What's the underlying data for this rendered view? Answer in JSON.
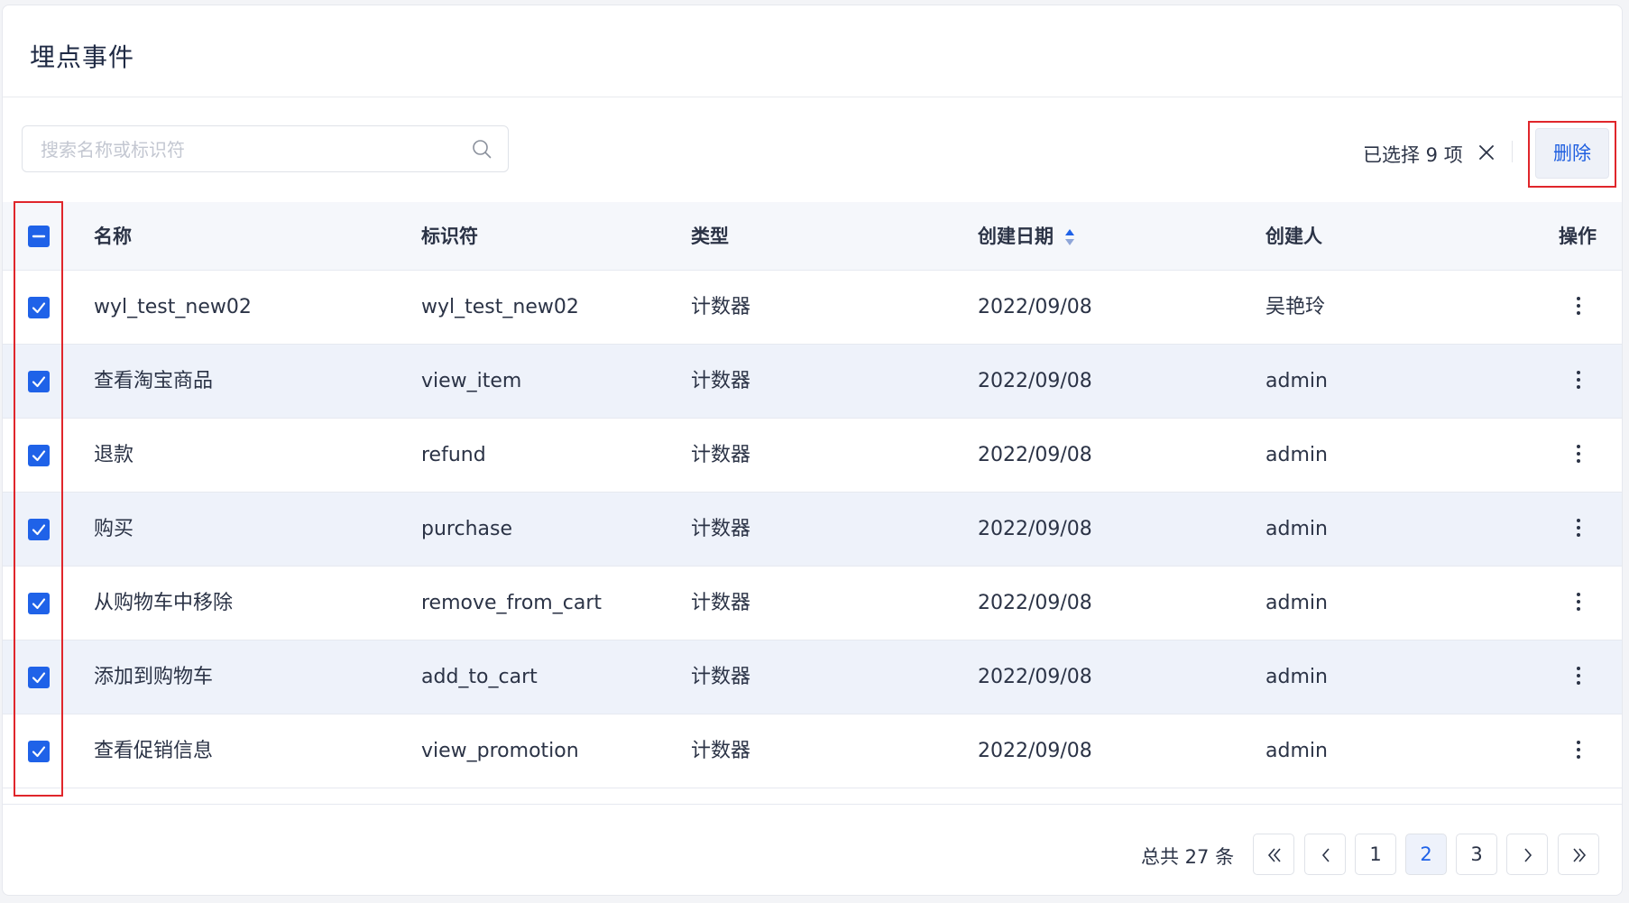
{
  "page_title": "埋点事件",
  "search": {
    "placeholder": "搜索名称或标识符",
    "value": ""
  },
  "selection": {
    "text": "已选择 9 项"
  },
  "toolbar": {
    "delete_label": "删除"
  },
  "colors": {
    "accent": "#1f62e8",
    "highlight_outline": "#e0262b"
  },
  "table": {
    "columns": {
      "name": "名称",
      "identifier": "标识符",
      "type": "类型",
      "created_date": "创建日期",
      "creator": "创建人",
      "actions": "操作"
    },
    "sorted_column": "created_date",
    "rows": [
      {
        "name": "wyl_test_new02",
        "identifier": "wyl_test_new02",
        "type": "计数器",
        "created_date": "2022/09/08",
        "creator": "吴艳玲",
        "checked": true
      },
      {
        "name": "查看淘宝商品",
        "identifier": "view_item",
        "type": "计数器",
        "created_date": "2022/09/08",
        "creator": "admin",
        "checked": true
      },
      {
        "name": "退款",
        "identifier": "refund",
        "type": "计数器",
        "created_date": "2022/09/08",
        "creator": "admin",
        "checked": true
      },
      {
        "name": "购买",
        "identifier": "purchase",
        "type": "计数器",
        "created_date": "2022/09/08",
        "creator": "admin",
        "checked": true
      },
      {
        "name": "从购物车中移除",
        "identifier": "remove_from_cart",
        "type": "计数器",
        "created_date": "2022/09/08",
        "creator": "admin",
        "checked": true
      },
      {
        "name": "添加到购物车",
        "identifier": "add_to_cart",
        "type": "计数器",
        "created_date": "2022/09/08",
        "creator": "admin",
        "checked": true
      },
      {
        "name": "查看促销信息",
        "identifier": "view_promotion",
        "type": "计数器",
        "created_date": "2022/09/08",
        "creator": "admin",
        "checked": true
      }
    ]
  },
  "pagination": {
    "total_text": "总共 27 条",
    "pages": [
      "1",
      "2",
      "3"
    ],
    "current_page": "2"
  }
}
